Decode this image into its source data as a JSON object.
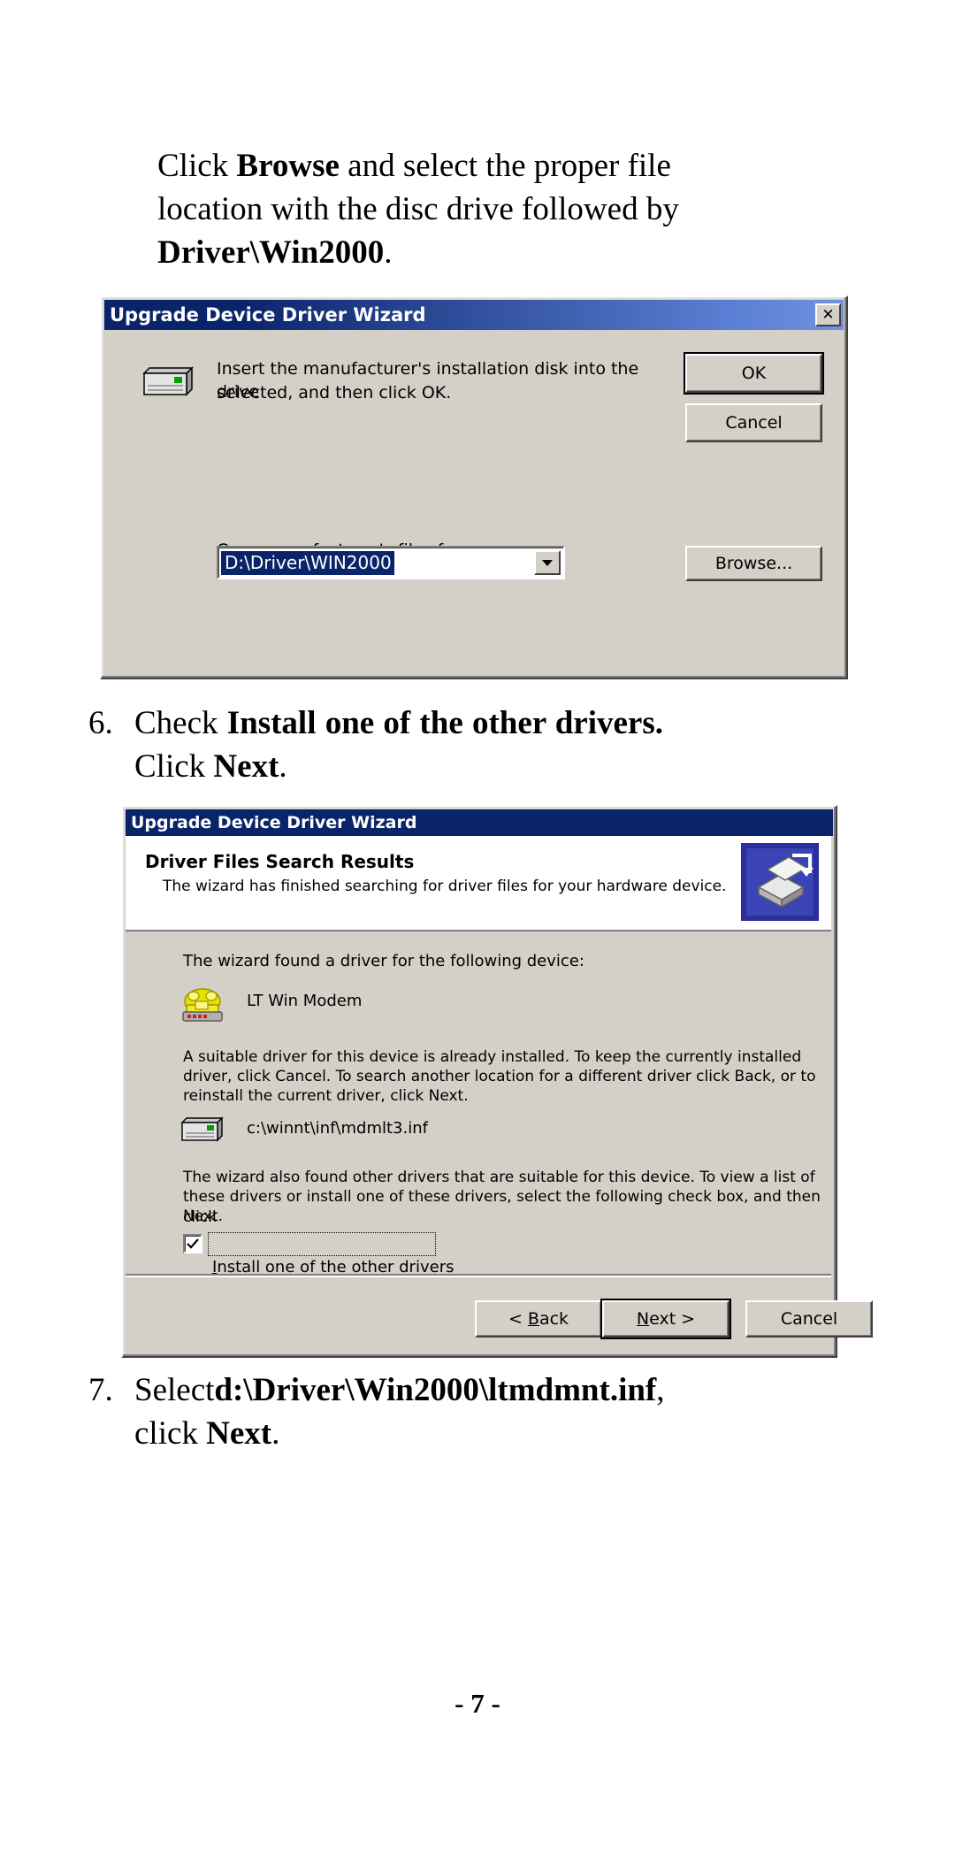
{
  "page": {
    "footer": "- 7 -"
  },
  "intro_paragraph": {
    "line1_pre": "Click ",
    "line1_bold": "Browse",
    "line1_post": " and select the proper file",
    "line2": "location with the disc drive followed by",
    "line3_bold": "Driver\\Win2000",
    "line3_post": "."
  },
  "dialog1": {
    "title": "Upgrade Device Driver Wizard",
    "close_label": "✕",
    "message_line1": "Insert the manufacturer's installation disk into the drive",
    "message_line2": "selected, and then click OK.",
    "ok_label": "OK",
    "cancel_label": "Cancel",
    "copy_from_label_accel": "C",
    "copy_from_label_rest": "opy manufacturer's files from:",
    "path_value": "D:\\Driver\\WIN2000",
    "browse_label": "Browse...",
    "disk_icon": "floppy-disk-icon",
    "dropdown_icon": "chevron-down-icon"
  },
  "step6": {
    "number": "6.",
    "text_pre": "Check ",
    "text_bold": "Install one of the other drivers.",
    "text_line2_pre": "Click ",
    "text_line2_bold": "Next",
    "text_line2_post": "."
  },
  "dialog2": {
    "title": "Upgrade Device Driver Wizard",
    "header_title": "Driver Files Search Results",
    "header_subtitle": "The wizard has finished searching for driver files for your hardware device.",
    "header_icon": "driver-search-icon",
    "found_label": "The wizard found a driver for the following device:",
    "device_name": "LT Win Modem",
    "device_icon": "modem-phone-icon",
    "paragraph1_line1": "A suitable driver for this device is already installed. To keep the currently installed",
    "paragraph1_line2": "driver, click Cancel. To search another location for a different driver click Back, or to",
    "paragraph1_line3": "reinstall the current driver, click Next.",
    "inf_path": "c:\\winnt\\inf\\mdmlt3.inf",
    "inf_icon": "floppy-disk-icon",
    "paragraph2_line1": "The wizard also found other drivers that are suitable for this device. To view a list of",
    "paragraph2_line2": "these drivers or install one of these drivers, select the following check box, and then click",
    "paragraph2_line3": "Next.",
    "checkbox_checked": true,
    "checkbox_accel": "I",
    "checkbox_label_rest": "nstall one of the other drivers",
    "back_label_pre": "< ",
    "back_label_accel": "B",
    "back_label_rest": "ack",
    "next_label_accel": "N",
    "next_label_rest": "ext >",
    "cancel_label": "Cancel"
  },
  "step7": {
    "number": "7.",
    "text_pre": "Select",
    "text_bold": "d:\\Driver\\Win2000\\ltmdmnt.inf",
    "text_post": ",",
    "line2_pre": "click ",
    "line2_bold": "Next",
    "line2_post": "."
  },
  "colors": {
    "title_navy": "#0a246a",
    "dialog_face": "#d4d0c8",
    "highlight": "#0a246a",
    "modem_yellow": "#e8e000"
  }
}
